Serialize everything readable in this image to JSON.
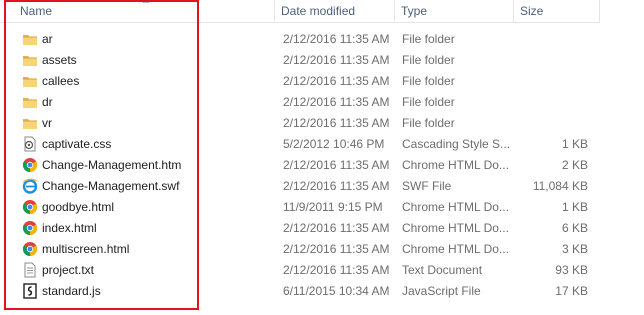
{
  "columns": {
    "name": "Name",
    "date": "Date modified",
    "type": "Type",
    "size": "Size"
  },
  "files": [
    {
      "name": "ar",
      "date": "2/12/2016 11:35 AM",
      "type": "File folder",
      "size": "",
      "icon": "folder-icon"
    },
    {
      "name": "assets",
      "date": "2/12/2016 11:35 AM",
      "type": "File folder",
      "size": "",
      "icon": "folder-icon"
    },
    {
      "name": "callees",
      "date": "2/12/2016 11:35 AM",
      "type": "File folder",
      "size": "",
      "icon": "folder-icon"
    },
    {
      "name": "dr",
      "date": "2/12/2016 11:35 AM",
      "type": "File folder",
      "size": "",
      "icon": "folder-icon"
    },
    {
      "name": "vr",
      "date": "2/12/2016 11:35 AM",
      "type": "File folder",
      "size": "",
      "icon": "folder-icon"
    },
    {
      "name": "captivate.css",
      "date": "5/2/2012 10:46 PM",
      "type": "Cascading Style S...",
      "size": "1 KB",
      "icon": "css-file-icon"
    },
    {
      "name": "Change-Management.htm",
      "date": "2/12/2016 11:35 AM",
      "type": "Chrome HTML Do...",
      "size": "2 KB",
      "icon": "chrome-icon"
    },
    {
      "name": "Change-Management.swf",
      "date": "2/12/2016 11:35 AM",
      "type": "SWF File",
      "size": "11,084 KB",
      "icon": "ie-icon"
    },
    {
      "name": "goodbye.html",
      "date": "11/9/2011 9:15 PM",
      "type": "Chrome HTML Do...",
      "size": "1 KB",
      "icon": "chrome-icon"
    },
    {
      "name": "index.html",
      "date": "2/12/2016 11:35 AM",
      "type": "Chrome HTML Do...",
      "size": "6 KB",
      "icon": "chrome-icon"
    },
    {
      "name": "multiscreen.html",
      "date": "2/12/2016 11:35 AM",
      "type": "Chrome HTML Do...",
      "size": "3 KB",
      "icon": "chrome-icon"
    },
    {
      "name": "project.txt",
      "date": "2/12/2016 11:35 AM",
      "type": "Text Document",
      "size": "93 KB",
      "icon": "text-file-icon"
    },
    {
      "name": "standard.js",
      "date": "6/11/2015 10:34 AM",
      "type": "JavaScript File",
      "size": "17 KB",
      "icon": "js-file-icon"
    }
  ],
  "colors": {
    "highlight_border": "#e0151c",
    "header_text": "#4c607a",
    "secondary_text": "#6d6d6d"
  }
}
